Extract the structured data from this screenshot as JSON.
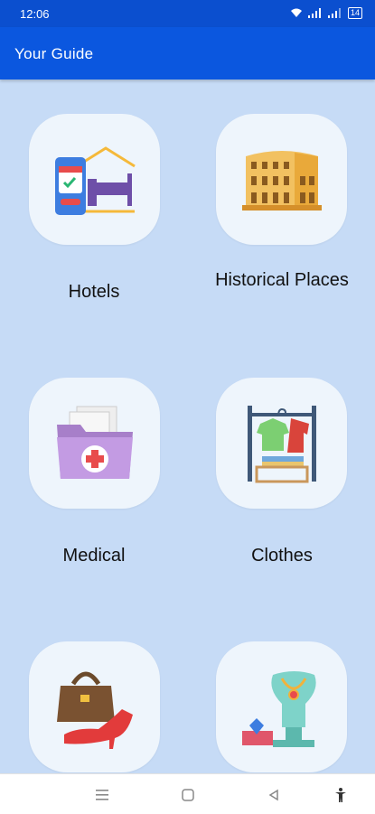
{
  "status_bar": {
    "time": "12:06",
    "battery": "14"
  },
  "app_bar": {
    "title": "Your Guide"
  },
  "categories": [
    {
      "label": "Hotels",
      "icon": "hotel-icon"
    },
    {
      "label": "Historical Places",
      "icon": "colosseum-icon"
    },
    {
      "label": "Medical",
      "icon": "medical-folder-icon"
    },
    {
      "label": "Clothes",
      "icon": "clothes-rack-icon"
    },
    {
      "label": "",
      "icon": "bag-and-shoe-icon"
    },
    {
      "label": "",
      "icon": "jewelry-icon"
    }
  ],
  "nav_bar": {
    "items": [
      "menu-icon",
      "home-icon",
      "back-icon",
      "accessibility-icon"
    ]
  }
}
